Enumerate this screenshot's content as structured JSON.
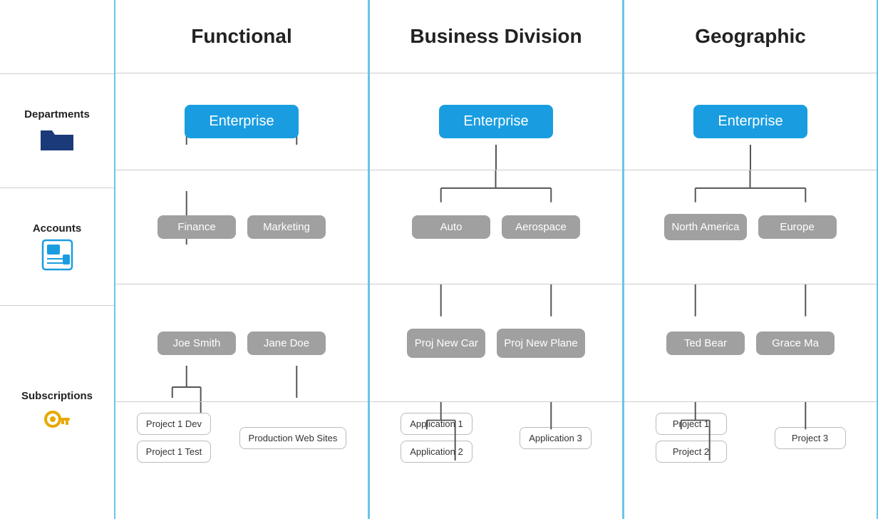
{
  "headers": {
    "functional": "Functional",
    "businessDivision": "Business Division",
    "geographic": "Geographic"
  },
  "labels": {
    "departments": "Departments",
    "accounts": "Accounts",
    "subscriptions": "Subscriptions"
  },
  "functional": {
    "enterprise": "Enterprise",
    "depts": [
      "Finance",
      "Marketing"
    ],
    "accounts": [
      "Joe Smith",
      "Jane Doe"
    ],
    "joeSmithSubs": [
      "Project 1 Dev",
      "Project 1 Test"
    ],
    "janeDoesSubs": [
      "Production Web Sites"
    ]
  },
  "businessDivision": {
    "enterprise": "Enterprise",
    "depts": [
      "Auto",
      "Aerospace"
    ],
    "accounts": [
      "Proj New Car",
      "Proj New Plane"
    ],
    "autoSubs": [
      "Application 1",
      "Application 2"
    ],
    "aeroSubs": [
      "Application 3"
    ]
  },
  "geographic": {
    "enterprise": "Enterprise",
    "depts": [
      "North America",
      "Europe"
    ],
    "accounts": [
      "Ted Bear",
      "Grace Ma"
    ],
    "northAmericaSubs": [
      "Project 1",
      "Project 2"
    ],
    "europeSubs": [
      "Project 3"
    ]
  }
}
